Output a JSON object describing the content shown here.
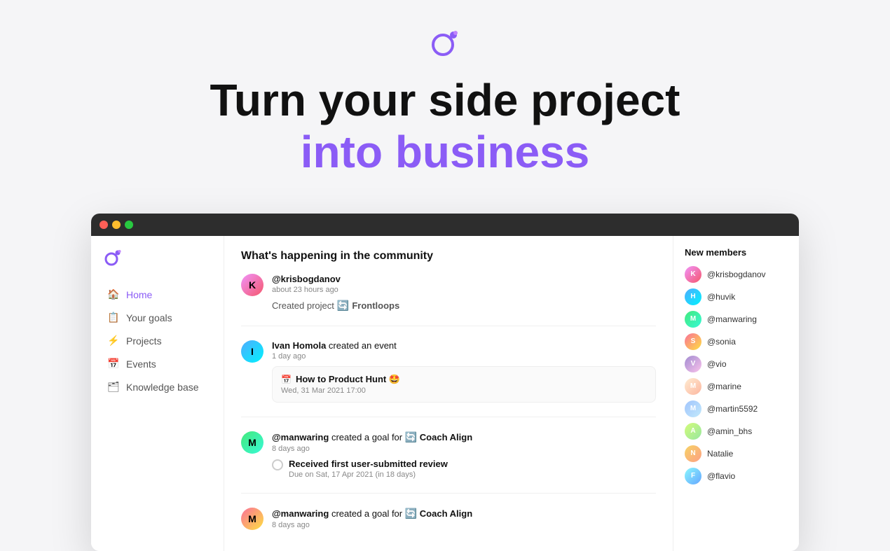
{
  "hero": {
    "title_black": "Turn your side project",
    "title_purple": "into business"
  },
  "sidebar": {
    "logo_alt": "Frontloops logo",
    "nav_items": [
      {
        "id": "home",
        "label": "Home",
        "icon": "🏠",
        "active": true
      },
      {
        "id": "your-goals",
        "label": "Your goals",
        "icon": "📋",
        "active": false
      },
      {
        "id": "projects",
        "label": "Projects",
        "icon": "⚡",
        "active": false
      },
      {
        "id": "events",
        "label": "Events",
        "icon": "📅",
        "active": false
      },
      {
        "id": "knowledge-base",
        "label": "Knowledge base",
        "icon": "🗂",
        "active": false
      }
    ]
  },
  "main": {
    "section_title": "What's happening in the community",
    "activities": [
      {
        "id": "activity-1",
        "user": "@krisbogdanov",
        "time": "about 23 hours ago",
        "action": "Created project",
        "project_emoji": "🔄",
        "project_name": "Frontloops"
      },
      {
        "id": "activity-2",
        "user": "Ivan Homola",
        "action_suffix": "created an event",
        "time": "1 day ago",
        "event_icon": "📅",
        "event_title": "How to Product Hunt 🤩",
        "event_date": "Wed, 31 Mar 2021 17:00"
      },
      {
        "id": "activity-3",
        "user": "@manwaring",
        "action": "created a goal for",
        "project_icon": "🔄",
        "project_name": "Coach Align",
        "time": "8 days ago",
        "goal_text": "Received first user-submitted review",
        "goal_due": "Due on Sat, 17 Apr 2021 (in 18 days)"
      },
      {
        "id": "activity-4",
        "user": "@manwaring",
        "action": "created a goal for",
        "project_icon": "🔄",
        "project_name": "Coach Align",
        "time": "8 days ago"
      }
    ]
  },
  "right_sidebar": {
    "title": "New members",
    "members": [
      {
        "id": "m1",
        "name": "@krisbogdanov",
        "avatar_class": "av-1"
      },
      {
        "id": "m2",
        "name": "@huvik",
        "avatar_class": "av-2"
      },
      {
        "id": "m3",
        "name": "@manwaring",
        "avatar_class": "av-3"
      },
      {
        "id": "m4",
        "name": "@sonia",
        "avatar_class": "av-4"
      },
      {
        "id": "m5",
        "name": "@vio",
        "avatar_class": "av-5"
      },
      {
        "id": "m6",
        "name": "@marine",
        "avatar_class": "av-6"
      },
      {
        "id": "m7",
        "name": "@martin5592",
        "avatar_class": "av-7"
      },
      {
        "id": "m8",
        "name": "@amin_bhs",
        "avatar_class": "av-8"
      },
      {
        "id": "m9",
        "name": "Natalie",
        "avatar_class": "av-9"
      },
      {
        "id": "m10",
        "name": "@flavio",
        "avatar_class": "av-10"
      }
    ]
  }
}
